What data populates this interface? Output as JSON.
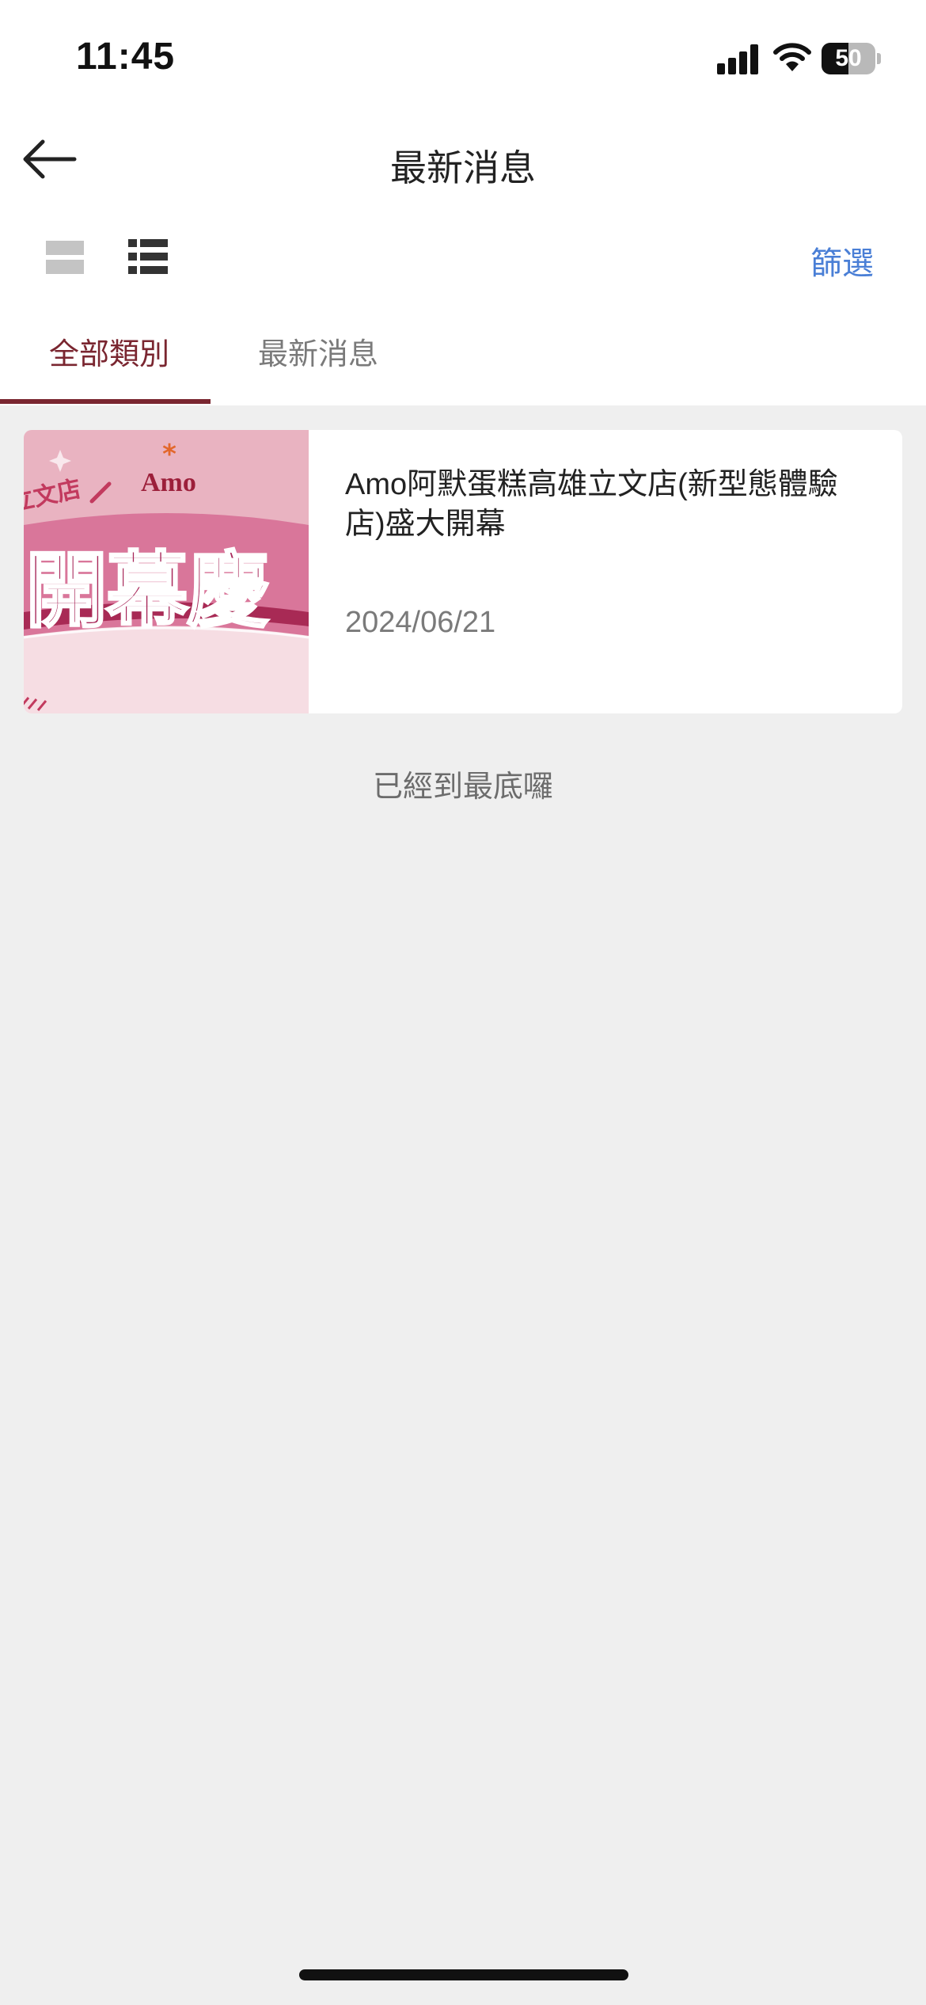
{
  "status_bar": {
    "time": "11:45",
    "battery": "50",
    "battery_level": 0.5
  },
  "nav": {
    "title": "最新消息"
  },
  "toolbar": {
    "filter_label": "篩選"
  },
  "tabs": [
    {
      "label": "全部類別",
      "active": true
    },
    {
      "label": "最新消息",
      "active": false
    }
  ],
  "news": [
    {
      "title": "Amo阿默蛋糕高雄立文店(新型態體驗店)盛大開幕",
      "date": "2024/06/21",
      "image": {
        "logo": "Amo",
        "banner_text": "開幕慶",
        "side_text": "立文店"
      }
    }
  ],
  "end_message": "已經到最底囉",
  "colors": {
    "accent": "#7a2630",
    "link": "#4a7fd6",
    "background": "#efefef",
    "thumb_pink": "#e7aebd",
    "thumb_magenta": "#b8325f"
  }
}
